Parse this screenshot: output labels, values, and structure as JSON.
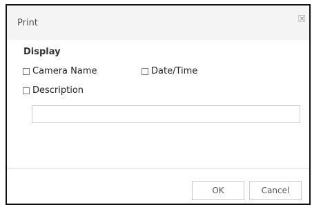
{
  "dialog": {
    "title": "Print",
    "close_icon": "close-icon"
  },
  "display": {
    "section_label": "Display",
    "options": {
      "camera_name": {
        "label": "Camera Name",
        "checked": false
      },
      "date_time": {
        "label": "Date/Time",
        "checked": false
      },
      "description": {
        "label": "Description",
        "checked": false
      }
    },
    "description_input": {
      "value": "",
      "placeholder": ""
    }
  },
  "buttons": {
    "ok": "OK",
    "cancel": "Cancel"
  }
}
